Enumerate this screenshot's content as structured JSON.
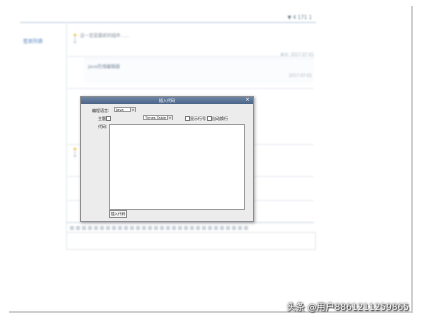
{
  "topbar": {
    "stats": "▼ 4 171 1"
  },
  "sidebar": {
    "link": "签到列表"
  },
  "posts": [
    {
      "text": "这一定是最新的插件……",
      "meta": "来自: 2017-07-01"
    },
    {
      "text": "java在线编辑器",
      "meta": "2017-07-01"
    }
  ],
  "modal": {
    "title": "插入代码",
    "close_icon": "close-icon",
    "language_label": "编程语言:",
    "language_value": "Java",
    "theme_label": "主题:",
    "theme_value": "Times Table",
    "option1_label": "显示行号",
    "option2_label": "自动换行",
    "code_label": "代码:",
    "insert_button": "插入代码"
  },
  "watermark": "头条 @用户8861211259865",
  "colors": {
    "title_bar": "#4a6487",
    "link": "#3d6fb6"
  }
}
